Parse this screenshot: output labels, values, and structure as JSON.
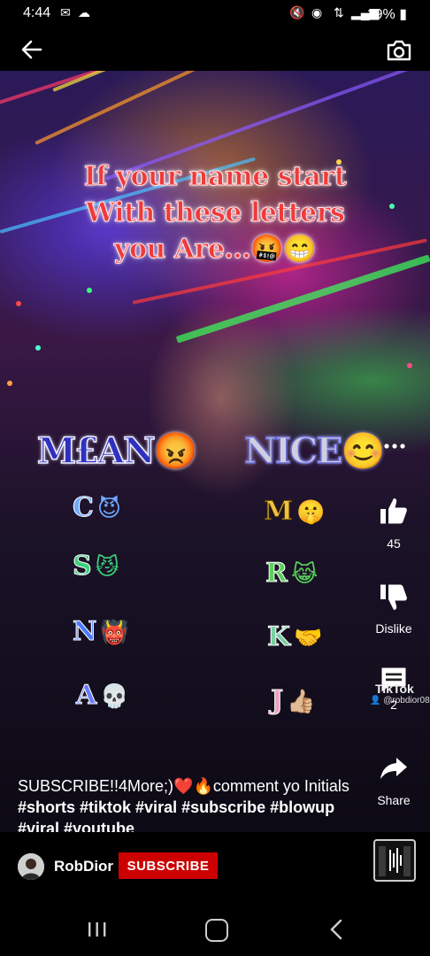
{
  "status_bar": {
    "time": "4:44",
    "battery": "19%"
  },
  "video": {
    "headline": [
      "If your name start",
      "With these letters",
      "you Are...🤬😁"
    ],
    "mean_label": "M£AN😡",
    "nice_label": "NICE😊",
    "mean_letters": [
      {
        "letter": "C",
        "emoji": "😈"
      },
      {
        "letter": "S",
        "emoji": "😼"
      },
      {
        "letter": "N",
        "emoji": "👹"
      },
      {
        "letter": "A",
        "emoji": "💀"
      }
    ],
    "nice_letters": [
      {
        "letter": "M",
        "emoji": "🤫"
      },
      {
        "letter": "R",
        "emoji": "😹"
      },
      {
        "letter": "K",
        "emoji": "🤝"
      },
      {
        "letter": "J",
        "emoji": "👍🏼"
      }
    ],
    "watermark_title": "TikTok",
    "watermark_user": "@robdior08"
  },
  "actions": {
    "like_count": "45",
    "dislike_label": "Dislike",
    "comment_count": "2",
    "share_label": "Share"
  },
  "caption": {
    "text": "SUBSCRIBE!!4More;)❤️🔥comment yo Initials ",
    "tags": "#shorts #tiktok #viral #subscribe #blowup #viral #youtube"
  },
  "channel": {
    "name": "RobDior",
    "subscribe_label": "SUBSCRIBE"
  },
  "colors": {
    "subscribe": "#cc0000",
    "mean": "#3030c0",
    "headline": "#f03a3a"
  }
}
